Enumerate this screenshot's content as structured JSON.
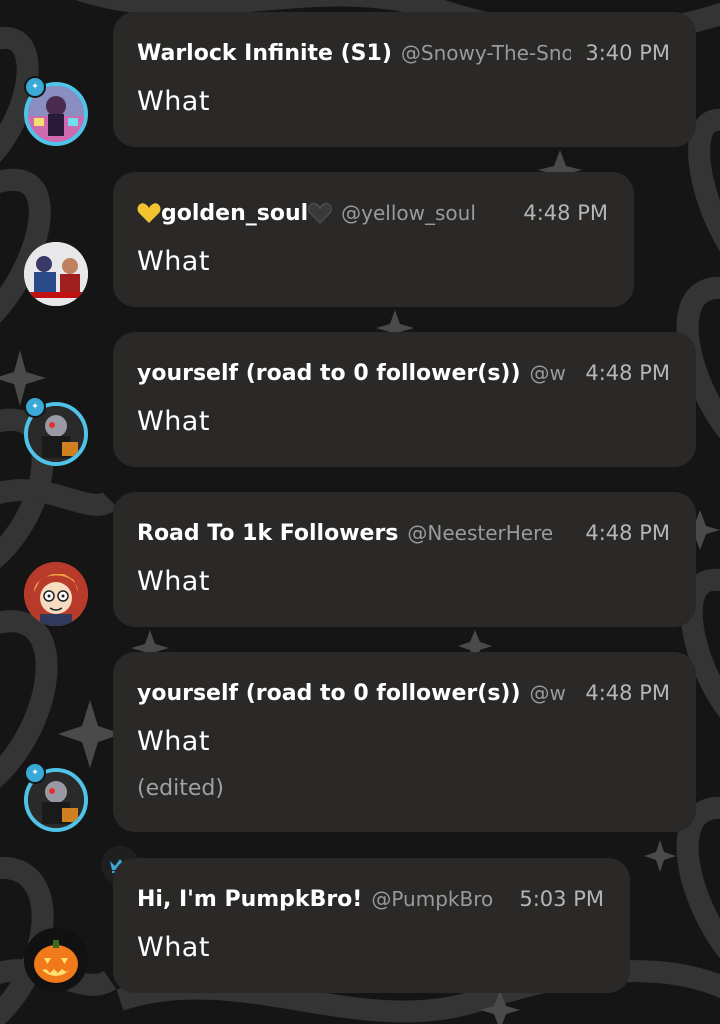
{
  "colors": {
    "bubble_bg": "#2a2928",
    "accent_ring": "#4fc3e8",
    "page_bg": "#151515",
    "name_text": "#ffffff",
    "meta_text": "#9a9a9a",
    "crown": "#3aa9d8"
  },
  "messages": [
    {
      "name": "Warlock Infinite (S1)",
      "handle": "@Snowy-The-Snowflake",
      "time": "3:40 PM",
      "text": "What",
      "avatar_icon": "anime-character-avatar"
    },
    {
      "name": "golden_soul",
      "name_prefix_icon": "yellow-heart-icon",
      "name_suffix_icon": "black-heart-icon",
      "handle": "@yellow_soul",
      "time": "4:48 PM",
      "text": "What",
      "avatar_icon": "photo-avatar"
    },
    {
      "name": "yourself (road to 0 follower(s))",
      "handle": "@w",
      "time": "4:48 PM",
      "text": "What",
      "avatar_icon": "robot-character-avatar"
    },
    {
      "name": "Road To 1k Followers",
      "handle": "@NeesterHere",
      "time": "4:48 PM",
      "text": "What",
      "avatar_icon": "cartoon-face-avatar"
    },
    {
      "name": "yourself (road to 0 follower(s))",
      "handle": "@w",
      "time": "4:48 PM",
      "text": "What",
      "edited": "(edited)",
      "avatar_icon": "robot-character-avatar"
    },
    {
      "name": "Hi, I'm PumpkBro!",
      "handle": "@PumpkBro",
      "time": "5:03 PM",
      "text": "What",
      "avatar_icon": "pumpkin-avatar",
      "badge_icon": "crown-icon"
    }
  ]
}
